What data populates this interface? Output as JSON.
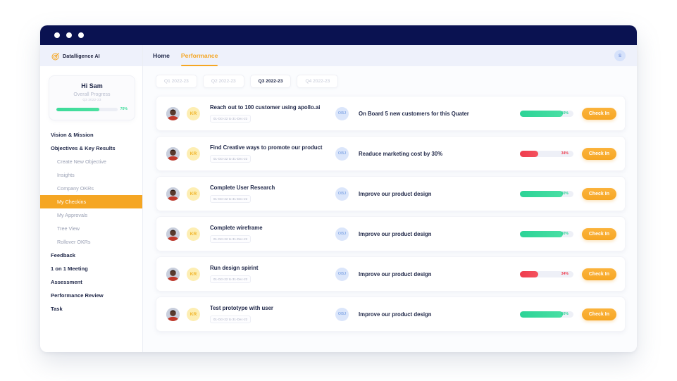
{
  "window": {
    "dots": [
      "dot-1",
      "dot-2",
      "dot-3"
    ]
  },
  "brand": {
    "name": "Datalligence AI",
    "logo_icon": "target-icon",
    "logo_color": "#f5a623"
  },
  "sidebar": {
    "profile_card": {
      "greeting": "Hi Sam",
      "subtitle": "Overall Progress",
      "quarter": "Q3 2022-23",
      "percent_label": "70%",
      "percent_value": 70,
      "bar_color": "#3ddb9a"
    },
    "items": [
      {
        "label": "Vision & Mission",
        "level": "top",
        "active": false
      },
      {
        "label": "Objectives & Key Results",
        "level": "top",
        "active": false
      },
      {
        "label": "Create New Objective",
        "level": "sub",
        "active": false
      },
      {
        "label": "Insights",
        "level": "sub",
        "active": false
      },
      {
        "label": "Company OKRs",
        "level": "sub",
        "active": false
      },
      {
        "label": "My  Checkins",
        "level": "sub",
        "active": true
      },
      {
        "label": "My Approvals",
        "level": "sub",
        "active": false
      },
      {
        "label": "Tree View",
        "level": "sub",
        "active": false
      },
      {
        "label": "Rollover OKRs",
        "level": "sub",
        "active": false
      },
      {
        "label": "Feedback",
        "level": "top",
        "active": false
      },
      {
        "label": "1 on 1 Meeting",
        "level": "top",
        "active": false
      },
      {
        "label": "Assessment",
        "level": "top",
        "active": false
      },
      {
        "label": "Performance Review",
        "level": "top",
        "active": false
      },
      {
        "label": "Task",
        "level": "top",
        "active": false
      }
    ],
    "active_color": "#f5a623"
  },
  "topbar": {
    "tabs": [
      {
        "label": "Home",
        "active": false
      },
      {
        "label": "Performance",
        "active": true
      }
    ],
    "user_avatar_initial": "S",
    "accent_color": "#f5a623"
  },
  "quarters": [
    {
      "label": "Q1 2022-23",
      "active": false
    },
    {
      "label": "Q2 2022-23",
      "active": false
    },
    {
      "label": "Q3 2022-23",
      "active": true
    },
    {
      "label": "Q4 2022-23",
      "active": false
    }
  ],
  "rows": [
    {
      "avatar": "user-photo",
      "kr_badge": "KR",
      "kr_title": "Reach out to 100 customer using apollo.ai",
      "kr_date": "01-Oct-22 to 31-Dec-22",
      "obj_badge": "OBJ",
      "obj_title": "On Board 5 new customers for this Quater",
      "progress_percent": 80,
      "progress_label": "80%",
      "progress_status": "green",
      "action_label": "Check In"
    },
    {
      "avatar": "user-photo",
      "kr_badge": "KR",
      "kr_title": "Find Creative ways to promote our product",
      "kr_date": "01-Oct-22 to 31-Dec-22",
      "obj_badge": "OBJ",
      "obj_title": "Readuce marketing cost by 30%",
      "progress_percent": 34,
      "progress_label": "34%",
      "progress_status": "red",
      "action_label": "Check In"
    },
    {
      "avatar": "user-photo",
      "kr_badge": "KR",
      "kr_title": "Complete User Research",
      "kr_date": "01-Oct-22 to 31-Dec-22",
      "obj_badge": "OBJ",
      "obj_title": "Improve our product design",
      "progress_percent": 80,
      "progress_label": "80%",
      "progress_status": "green",
      "action_label": "Check In"
    },
    {
      "avatar": "user-photo",
      "kr_badge": "KR",
      "kr_title": "Complete wireframe",
      "kr_date": "01-Oct-22 to 31-Dec-22",
      "obj_badge": "OBJ",
      "obj_title": "Improve our product design",
      "progress_percent": 80,
      "progress_label": "80%",
      "progress_status": "green",
      "action_label": "Check In"
    },
    {
      "avatar": "user-photo",
      "kr_badge": "KR",
      "kr_title": "Run design spirint",
      "kr_date": "01-Oct-22 to 31-Dec-22",
      "obj_badge": "OBJ",
      "obj_title": "Improve our product design",
      "progress_percent": 34,
      "progress_label": "34%",
      "progress_status": "red",
      "action_label": "Check In"
    },
    {
      "avatar": "user-photo",
      "kr_badge": "KR",
      "kr_title": "Test prototype with user",
      "kr_date": "01-Oct-22 to 31-Dec-22",
      "obj_badge": "OBJ",
      "obj_title": "Improve our product design",
      "progress_percent": 80,
      "progress_label": "80%",
      "progress_status": "green",
      "action_label": "Check In"
    }
  ],
  "colors": {
    "titlebar": "#0a1251",
    "accent": "#f5a623",
    "green": "#2bd396",
    "red": "#ef3b4c",
    "header_bg": "#eef1fb"
  }
}
